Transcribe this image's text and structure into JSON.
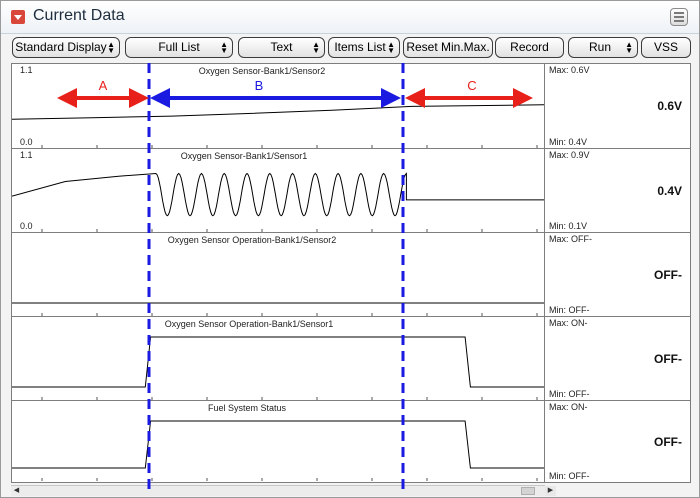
{
  "window": {
    "title": "Current Data",
    "colors": {
      "title_icon": "#d9473a",
      "title_text": "#1e2e3e"
    }
  },
  "toolbar": {
    "buttons": [
      {
        "label": "Standard Display",
        "dropdown": true
      },
      {
        "label": "Full List",
        "dropdown": true
      },
      {
        "label": "Text",
        "dropdown": true
      },
      {
        "label": "Items List",
        "dropdown": true
      },
      {
        "label": "Reset Min.Max.",
        "dropdown": false
      },
      {
        "label": "Record",
        "dropdown": false
      },
      {
        "label": "Run",
        "dropdown": true
      },
      {
        "label": "VSS",
        "dropdown": false
      }
    ]
  },
  "graphs": [
    {
      "title": "Oxygen Sensor-Bank1/Sensor2",
      "y_max": "1.1",
      "y_min": "0.0",
      "max_label": "Max:  0.6V",
      "min_label": "Min:  0.4V",
      "current_value": "0.6V",
      "trace_color": "#000000",
      "chart_data": {
        "type": "line",
        "ylim": [
          0,
          1.1
        ],
        "series": [
          {
            "x": [
              0,
              0.15,
              0.3,
              0.45,
              0.6,
              0.75,
              1.0
            ],
            "y": [
              0.33,
              0.36,
              0.39,
              0.44,
              0.5,
              0.57,
              0.6
            ]
          }
        ]
      }
    },
    {
      "title": "Oxygen Sensor-Bank1/Sensor1",
      "y_max": "1.1",
      "y_min": "0.0",
      "max_label": "Max:  0.9V",
      "min_label": "Min:  0.1V",
      "current_value": "0.4V",
      "trace_color": "#000000",
      "chart_data": {
        "type": "line",
        "ylim": [
          0,
          1.1
        ],
        "series": [
          {
            "x": [
              0,
              0.1,
              0.2,
              0.27,
              0.74,
              1.0
            ],
            "y": [
              0.47,
              0.75,
              0.85,
              0.9,
              0.9,
              0.4
            ],
            "note_segment": "oscillation 0.28-0.74 between 0.1 and 0.9 (11 cycles)"
          }
        ]
      }
    },
    {
      "title": "Oxygen Sensor Operation-Bank1/Sensor2",
      "y_max": "",
      "y_min": "",
      "max_label": "Max: OFF-",
      "min_label": "Min:  OFF-",
      "current_value": "OFF-",
      "trace_color": "#000000",
      "chart_data": {
        "type": "line",
        "states": [
          "OFF",
          "ON"
        ],
        "series": [
          {
            "x": [
              0,
              1.0
            ],
            "y": [
              "OFF",
              "OFF"
            ]
          }
        ]
      }
    },
    {
      "title": "Oxygen Sensor Operation-Bank1/Sensor1",
      "y_max": "",
      "y_min": "",
      "max_label": "Max: ON-",
      "min_label": "Min:  OFF-",
      "current_value": "OFF-",
      "trace_color": "#000000",
      "chart_data": {
        "type": "line",
        "states": [
          "OFF",
          "ON"
        ],
        "series": [
          {
            "x": [
              0,
              0.25,
              0.26,
              0.85,
              0.86,
              1.0
            ],
            "y": [
              "OFF",
              "OFF",
              "ON",
              "ON",
              "OFF",
              "OFF"
            ]
          }
        ]
      }
    },
    {
      "title": "Fuel System Status",
      "y_max": "",
      "y_min": "",
      "max_label": "Max: ON-",
      "min_label": "Min:  OFF-",
      "current_value": "OFF-",
      "trace_color": "#000000",
      "chart_data": {
        "type": "line",
        "states": [
          "OFF",
          "ON"
        ],
        "series": [
          {
            "x": [
              0,
              0.25,
              0.26,
              0.85,
              0.86,
              1.0
            ],
            "y": [
              "OFF",
              "OFF",
              "ON",
              "ON",
              "OFF",
              "OFF"
            ]
          }
        ]
      }
    }
  ],
  "annotations": {
    "regions": [
      {
        "label": "A",
        "color": "#e8201a"
      },
      {
        "label": "B",
        "color": "#1a1ae0"
      },
      {
        "label": "C",
        "color": "#e8201a"
      }
    ],
    "divider_color": "#1a1ae0"
  }
}
